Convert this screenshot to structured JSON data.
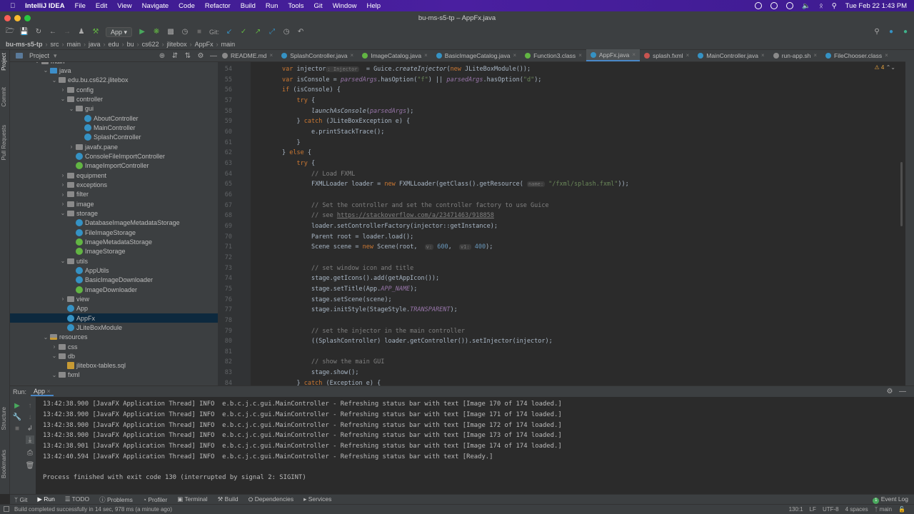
{
  "menubar": {
    "app": "IntelliJ IDEA",
    "items": [
      "File",
      "Edit",
      "View",
      "Navigate",
      "Code",
      "Refactor",
      "Build",
      "Run",
      "Tools",
      "Git",
      "Window",
      "Help"
    ],
    "datetime": "Tue Feb 22  1:43 PM"
  },
  "window": {
    "title": "bu-ms-s5-tp – AppFx.java"
  },
  "toolbar": {
    "run_config": "App",
    "git_label": "Git:"
  },
  "breadcrumb": [
    "bu-ms-s5-tp",
    "src",
    "main",
    "java",
    "edu",
    "bu",
    "cs622",
    "jlitebox",
    "AppFx",
    "main"
  ],
  "side_tabs": {
    "project": "Project",
    "commit": "Commit",
    "pull_requests": "Pull Requests",
    "structure": "Structure",
    "bookmarks": "Bookmarks"
  },
  "project": {
    "header": "Project",
    "tree": [
      {
        "label": "main",
        "depth": 0,
        "type": "folder",
        "state": "open"
      },
      {
        "label": "java",
        "depth": 1,
        "type": "srcfolder",
        "state": "open"
      },
      {
        "label": "edu.bu.cs622.jlitebox",
        "depth": 2,
        "type": "folder",
        "state": "open"
      },
      {
        "label": "config",
        "depth": 3,
        "type": "folder",
        "state": "closed"
      },
      {
        "label": "controller",
        "depth": 3,
        "type": "folder",
        "state": "open"
      },
      {
        "label": "gui",
        "depth": 4,
        "type": "folder",
        "state": "open"
      },
      {
        "label": "AboutController",
        "depth": 5,
        "type": "class",
        "state": "leaf"
      },
      {
        "label": "MainController",
        "depth": 5,
        "type": "class",
        "state": "leaf"
      },
      {
        "label": "SplashController",
        "depth": 5,
        "type": "class",
        "state": "leaf"
      },
      {
        "label": "javafx.pane",
        "depth": 4,
        "type": "folder",
        "state": "closed"
      },
      {
        "label": "ConsoleFileImportController",
        "depth": 4,
        "type": "class",
        "state": "leaf"
      },
      {
        "label": "ImageImportController",
        "depth": 4,
        "type": "iface",
        "state": "leaf"
      },
      {
        "label": "equipment",
        "depth": 3,
        "type": "folder",
        "state": "closed"
      },
      {
        "label": "exceptions",
        "depth": 3,
        "type": "folder",
        "state": "closed"
      },
      {
        "label": "filter",
        "depth": 3,
        "type": "folder",
        "state": "closed"
      },
      {
        "label": "image",
        "depth": 3,
        "type": "folder",
        "state": "closed"
      },
      {
        "label": "storage",
        "depth": 3,
        "type": "folder",
        "state": "open"
      },
      {
        "label": "DatabaseImageMetadataStorage",
        "depth": 4,
        "type": "class",
        "state": "leaf"
      },
      {
        "label": "FileImageStorage",
        "depth": 4,
        "type": "class",
        "state": "leaf"
      },
      {
        "label": "ImageMetadataStorage",
        "depth": 4,
        "type": "iface",
        "state": "leaf"
      },
      {
        "label": "ImageStorage",
        "depth": 4,
        "type": "iface",
        "state": "leaf"
      },
      {
        "label": "utils",
        "depth": 3,
        "type": "folder",
        "state": "open"
      },
      {
        "label": "AppUtils",
        "depth": 4,
        "type": "class",
        "state": "leaf"
      },
      {
        "label": "BasicImageDownloader",
        "depth": 4,
        "type": "class",
        "state": "leaf"
      },
      {
        "label": "ImageDownloader",
        "depth": 4,
        "type": "iface",
        "state": "leaf"
      },
      {
        "label": "view",
        "depth": 3,
        "type": "folder",
        "state": "closed"
      },
      {
        "label": "App",
        "depth": 3,
        "type": "class",
        "state": "leaf"
      },
      {
        "label": "AppFx",
        "depth": 3,
        "type": "class",
        "state": "leaf",
        "selected": true
      },
      {
        "label": "JLiteBoxModule",
        "depth": 3,
        "type": "class",
        "state": "leaf"
      },
      {
        "label": "resources",
        "depth": 1,
        "type": "res",
        "state": "open"
      },
      {
        "label": "css",
        "depth": 2,
        "type": "folder",
        "state": "closed"
      },
      {
        "label": "db",
        "depth": 2,
        "type": "folder",
        "state": "open"
      },
      {
        "label": "jlitebox-tables.sql",
        "depth": 3,
        "type": "sql",
        "state": "leaf"
      },
      {
        "label": "fxml",
        "depth": 2,
        "type": "folder",
        "state": "open"
      }
    ]
  },
  "tabs": [
    {
      "label": "README.md",
      "color": "#8a8a8a"
    },
    {
      "label": "SplashController.java",
      "color": "#3592c4"
    },
    {
      "label": "ImageCatalog.java",
      "color": "#62b543"
    },
    {
      "label": "BasicImageCatalog.java",
      "color": "#3592c4"
    },
    {
      "label": "Function3.class",
      "color": "#62b543"
    },
    {
      "label": "AppFx.java",
      "color": "#3592c4",
      "active": true
    },
    {
      "label": "splash.fxml",
      "color": "#c75450"
    },
    {
      "label": "MainController.java",
      "color": "#3592c4"
    },
    {
      "label": "run-app.sh",
      "color": "#8a8a8a"
    },
    {
      "label": "FileChooser.class",
      "color": "#3592c4"
    }
  ],
  "editor": {
    "inspections": "4",
    "lines": [
      {
        "n": "54",
        "indent": 2,
        "t": [
          [
            "kw",
            "var "
          ],
          [
            "",
            "injector"
          ],
          [
            "hint",
            ": Injector"
          ],
          [
            "",
            "  = Guice."
          ],
          [
            "fn",
            "createInjector"
          ],
          [
            "",
            "("
          ],
          [
            "kw",
            "new "
          ],
          [
            "",
            "JLiteBoxModule());"
          ]
        ]
      },
      {
        "n": "55",
        "indent": 2,
        "t": [
          [
            "kw",
            "var "
          ],
          [
            "",
            "isConsole = "
          ],
          [
            "par",
            "parsedArgs"
          ],
          [
            "",
            ".hasOption("
          ],
          [
            "str",
            "\"f\""
          ],
          [
            "",
            ") || "
          ],
          [
            "par",
            "parsedArgs"
          ],
          [
            "",
            ".hasOption("
          ],
          [
            "str",
            "\"d\""
          ],
          [
            "",
            ");"
          ]
        ]
      },
      {
        "n": "56",
        "indent": 2,
        "t": [
          [
            "kw",
            "if "
          ],
          [
            "",
            "(isConsole) {"
          ]
        ]
      },
      {
        "n": "57",
        "indent": 3,
        "t": [
          [
            "kw",
            "try "
          ],
          [
            "",
            "{"
          ]
        ]
      },
      {
        "n": "58",
        "indent": 4,
        "t": [
          [
            "fn",
            "launchAsConsole"
          ],
          [
            "",
            "("
          ],
          [
            "par",
            "parsedArgs"
          ],
          [
            "",
            ");"
          ]
        ]
      },
      {
        "n": "59",
        "indent": 3,
        "t": [
          [
            "",
            "} "
          ],
          [
            "kw",
            "catch "
          ],
          [
            "",
            "(JLiteBoxException e) {"
          ]
        ]
      },
      {
        "n": "60",
        "indent": 4,
        "t": [
          [
            "",
            "e.printStackTrace();"
          ]
        ]
      },
      {
        "n": "61",
        "indent": 3,
        "t": [
          [
            "",
            "}"
          ]
        ]
      },
      {
        "n": "62",
        "indent": 2,
        "t": [
          [
            "",
            "} "
          ],
          [
            "kw",
            "else "
          ],
          [
            "",
            "{"
          ]
        ]
      },
      {
        "n": "63",
        "indent": 3,
        "t": [
          [
            "kw",
            "try "
          ],
          [
            "",
            "{"
          ]
        ]
      },
      {
        "n": "64",
        "indent": 4,
        "t": [
          [
            "cmt",
            "// Load FXML"
          ]
        ]
      },
      {
        "n": "65",
        "indent": 4,
        "t": [
          [
            "",
            "FXMLLoader loader = "
          ],
          [
            "kw",
            "new "
          ],
          [
            "",
            "FXMLLoader(getClass().getResource( "
          ],
          [
            "hint",
            "name:"
          ],
          [
            "str",
            " \"/fxml/splash.fxml\""
          ],
          [
            "",
            "));"
          ]
        ]
      },
      {
        "n": "66",
        "indent": 4,
        "t": []
      },
      {
        "n": "67",
        "indent": 4,
        "t": [
          [
            "cmt",
            "// Set the controller and set the controller factory to use Guice"
          ]
        ]
      },
      {
        "n": "68",
        "indent": 4,
        "t": [
          [
            "cmt",
            "// see "
          ],
          [
            "lnk",
            "https://stackoverflow.com/a/23471463/918858"
          ]
        ]
      },
      {
        "n": "69",
        "indent": 4,
        "t": [
          [
            "",
            "loader.setControllerFactory(injector::getInstance);"
          ]
        ]
      },
      {
        "n": "70",
        "indent": 4,
        "t": [
          [
            "",
            "Parent root = loader.load();"
          ]
        ]
      },
      {
        "n": "71",
        "indent": 4,
        "t": [
          [
            "",
            "Scene scene = "
          ],
          [
            "kw",
            "new "
          ],
          [
            "",
            "Scene(root,  "
          ],
          [
            "hint",
            "v:"
          ],
          [
            "num",
            " 600"
          ],
          [
            "",
            ",  "
          ],
          [
            "hint",
            "v1:"
          ],
          [
            "num",
            " 400"
          ],
          [
            "",
            ");"
          ]
        ]
      },
      {
        "n": "72",
        "indent": 4,
        "t": []
      },
      {
        "n": "73",
        "indent": 4,
        "t": [
          [
            "cmt",
            "// set window icon and title"
          ]
        ]
      },
      {
        "n": "74",
        "indent": 4,
        "t": [
          [
            "",
            "stage.getIcons().add(getAppIcon());"
          ]
        ]
      },
      {
        "n": "75",
        "indent": 4,
        "t": [
          [
            "",
            "stage.setTitle(App."
          ],
          [
            "fld",
            "APP_NAME"
          ],
          [
            "",
            ");"
          ]
        ]
      },
      {
        "n": "76",
        "indent": 4,
        "t": [
          [
            "",
            "stage.setScene(scene);"
          ]
        ]
      },
      {
        "n": "77",
        "indent": 4,
        "t": [
          [
            "",
            "stage.initStyle(StageStyle."
          ],
          [
            "fld",
            "TRANSPARENT"
          ],
          [
            "",
            ");"
          ]
        ]
      },
      {
        "n": "78",
        "indent": 4,
        "t": []
      },
      {
        "n": "79",
        "indent": 4,
        "t": [
          [
            "cmt",
            "// set the injector in the main controller"
          ]
        ]
      },
      {
        "n": "80",
        "indent": 4,
        "t": [
          [
            "",
            "((SplashController) loader.getController()).setInjector(injector);"
          ]
        ]
      },
      {
        "n": "81",
        "indent": 4,
        "t": []
      },
      {
        "n": "82",
        "indent": 4,
        "t": [
          [
            "cmt",
            "// show the main GUI"
          ]
        ]
      },
      {
        "n": "83",
        "indent": 4,
        "t": [
          [
            "",
            "stage.show();"
          ]
        ]
      },
      {
        "n": "84",
        "indent": 3,
        "t": [
          [
            "",
            "} "
          ],
          [
            "kw",
            "catch "
          ],
          [
            "",
            "(Exception e) {"
          ]
        ]
      }
    ]
  },
  "run": {
    "label": "Run:",
    "config_tab": "App",
    "console": [
      "13:42:38.900 [JavaFX Application Thread] INFO  e.b.c.j.c.gui.MainController - Refreshing status bar with text [Image 170 of 174 loaded.]",
      "13:42:38.900 [JavaFX Application Thread] INFO  e.b.c.j.c.gui.MainController - Refreshing status bar with text [Image 171 of 174 loaded.]",
      "13:42:38.900 [JavaFX Application Thread] INFO  e.b.c.j.c.gui.MainController - Refreshing status bar with text [Image 172 of 174 loaded.]",
      "13:42:38.900 [JavaFX Application Thread] INFO  e.b.c.j.c.gui.MainController - Refreshing status bar with text [Image 173 of 174 loaded.]",
      "13:42:38.901 [JavaFX Application Thread] INFO  e.b.c.j.c.gui.MainController - Refreshing status bar with text [Image 174 of 174 loaded.]",
      "13:42:40.594 [JavaFX Application Thread] INFO  e.b.c.j.c.gui.MainController - Refreshing status bar with text [Ready.]"
    ],
    "exit_message": "Process finished with exit code 130 (interrupted by signal 2: SIGINT)"
  },
  "tool_tabs": [
    "Git",
    "Run",
    "TODO",
    "Problems",
    "Profiler",
    "Terminal",
    "Build",
    "Dependencies",
    "Services"
  ],
  "event_log": {
    "count": "1",
    "label": "Event Log"
  },
  "status": {
    "message": "Build completed successfully in 14 sec, 978 ms (a minute ago)",
    "position": "130:1",
    "line_sep": "LF",
    "encoding": "UTF-8",
    "indent": "4 spaces",
    "branch": "main"
  }
}
